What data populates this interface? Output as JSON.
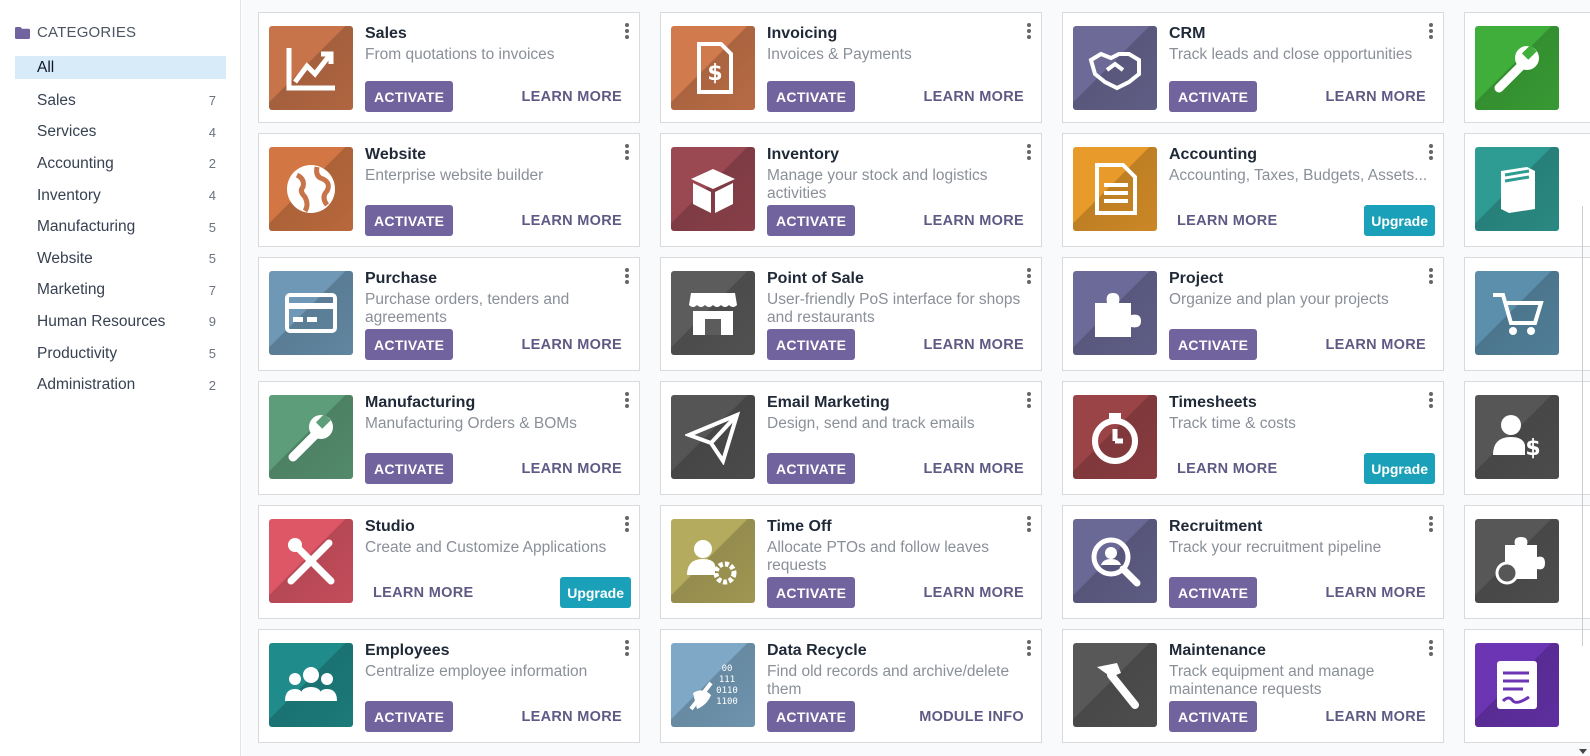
{
  "sidebar": {
    "header": "CATEGORIES",
    "items": [
      {
        "label": "All",
        "count": ""
      },
      {
        "label": "Sales",
        "count": "7"
      },
      {
        "label": "Services",
        "count": "4"
      },
      {
        "label": "Accounting",
        "count": "2"
      },
      {
        "label": "Inventory",
        "count": "4"
      },
      {
        "label": "Manufacturing",
        "count": "5"
      },
      {
        "label": "Website",
        "count": "5"
      },
      {
        "label": "Marketing",
        "count": "7"
      },
      {
        "label": "Human Resources",
        "count": "9"
      },
      {
        "label": "Productivity",
        "count": "5"
      },
      {
        "label": "Administration",
        "count": "2"
      }
    ]
  },
  "labels": {
    "activate": "ACTIVATE",
    "learn_more": "LEARN MORE",
    "upgrade": "Upgrade",
    "module_info": "MODULE INFO"
  },
  "apps": [
    {
      "title": "Sales",
      "desc": "From quotations to invoices",
      "icon": "chart-up-icon",
      "color": "#c8744a"
    },
    {
      "title": "Invoicing",
      "desc": "Invoices & Payments",
      "icon": "invoice-dollar-icon",
      "color": "#d07a4e"
    },
    {
      "title": "CRM",
      "desc": "Track leads and close opportunities",
      "icon": "handshake-icon",
      "color": "#6d6a97"
    },
    {
      "title": "",
      "desc": "",
      "icon": "wrench-icon",
      "color": "#3fae3a"
    },
    {
      "title": "Website",
      "desc": "Enterprise website builder",
      "icon": "globe-icon",
      "color": "#d27744"
    },
    {
      "title": "Inventory",
      "desc": "Manage your stock and logistics activities",
      "icon": "box-icon",
      "color": "#9a4852"
    },
    {
      "title": "Accounting",
      "desc": "Accounting, Taxes, Budgets, Assets...",
      "icon": "document-icon",
      "color": "#e89a2b"
    },
    {
      "title": "",
      "desc": "",
      "icon": "book-icon",
      "color": "#2f9c94"
    },
    {
      "title": "Purchase",
      "desc": "Purchase orders, tenders and agreements",
      "icon": "credit-card-icon",
      "color": "#6e98b6"
    },
    {
      "title": "Point of Sale",
      "desc": "User-friendly PoS interface for shops and restaurants",
      "icon": "shop-icon",
      "color": "#5c5c5c"
    },
    {
      "title": "Project",
      "desc": "Organize and plan your projects",
      "icon": "puzzle-icon",
      "color": "#6c6a98"
    },
    {
      "title": "",
      "desc": "",
      "icon": "cart-icon",
      "color": "#5b8fac"
    },
    {
      "title": "Manufacturing",
      "desc": "Manufacturing Orders & BOMs",
      "icon": "wrench-icon",
      "color": "#5e9d7a"
    },
    {
      "title": "Email Marketing",
      "desc": "Design, send and track emails",
      "icon": "paper-plane-icon",
      "color": "#555555"
    },
    {
      "title": "Timesheets",
      "desc": "Track time & costs",
      "icon": "stopwatch-icon",
      "color": "#9b4448"
    },
    {
      "title": "",
      "desc": "",
      "icon": "user-dollar-icon",
      "color": "#565656"
    },
    {
      "title": "Studio",
      "desc": "Create and Customize Applications",
      "icon": "tools-icon",
      "color": "#de5767"
    },
    {
      "title": "Time Off",
      "desc": "Allocate PTOs and follow leaves requests",
      "icon": "user-gear-icon",
      "color": "#b5ab5e"
    },
    {
      "title": "Recruitment",
      "desc": "Track your recruitment pipeline",
      "icon": "magnifier-user-icon",
      "color": "#6a6894"
    },
    {
      "title": "",
      "desc": "",
      "icon": "puzzle-timer-icon",
      "color": "#575757"
    },
    {
      "title": "Employees",
      "desc": "Centralize employee information",
      "icon": "users-icon",
      "color": "#1f8b8a"
    },
    {
      "title": "Data Recycle",
      "desc": "Find old records and archive/delete them",
      "icon": "broom-binary-icon",
      "color": "#7ea8c6"
    },
    {
      "title": "Maintenance",
      "desc": "Track equipment and manage maintenance requests",
      "icon": "hammer-icon",
      "color": "#585858"
    },
    {
      "title": "",
      "desc": "",
      "icon": "signature-doc-icon",
      "color": "#6b35b4"
    }
  ]
}
